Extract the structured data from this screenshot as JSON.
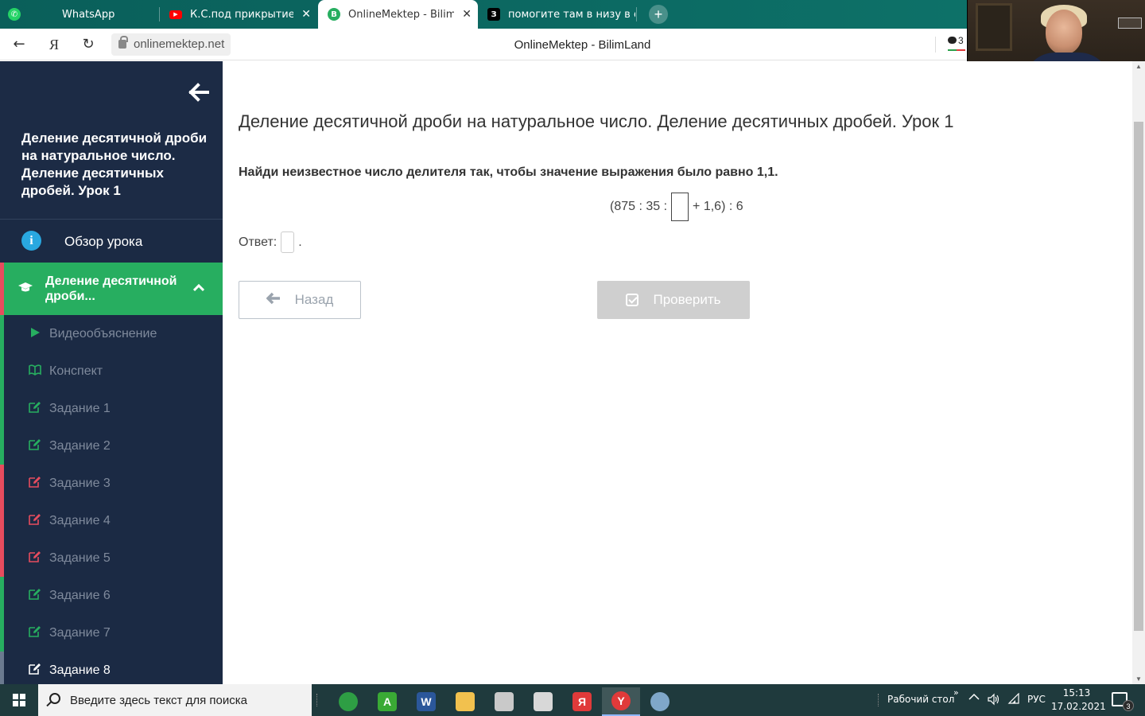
{
  "browser": {
    "tabs": [
      {
        "label": "WhatsApp",
        "icon": "whatsapp-icon"
      },
      {
        "label": "К.С.под прикрытием - С",
        "icon": "youtube-icon"
      },
      {
        "label": "OnlineMektep - BilimLa",
        "icon": "bilimland-icon"
      },
      {
        "label": "помогите там в низу в оте",
        "icon": "znanija-icon"
      }
    ],
    "url": "onlinemektep.net",
    "page_title": "OnlineMektep - BilimLand",
    "comment_count": "3",
    "yandex_glyph": "Я"
  },
  "sidebar": {
    "lesson_title": "Деление десятичной дроби на натуральное число. Деление десятичных дробей. Урок 1",
    "overview_label": "Обзор урока",
    "section_label": "Деление десятичной дроби...",
    "items": [
      {
        "label": "Видеообъяснение",
        "icon": "play-icon",
        "bar_color": "#27ae60",
        "icon_color": "#27ae60"
      },
      {
        "label": "Конспект",
        "icon": "book-icon",
        "bar_color": "#27ae60",
        "icon_color": "#27ae60"
      },
      {
        "label": "Задание 1",
        "icon": "edit-icon",
        "bar_color": "#27ae60",
        "icon_color": "#27ae60"
      },
      {
        "label": "Задание 2",
        "icon": "edit-icon",
        "bar_color": "#27ae60",
        "icon_color": "#27ae60"
      },
      {
        "label": "Задание 3",
        "icon": "edit-icon",
        "bar_color": "#e74c5e",
        "icon_color": "#e74c5e"
      },
      {
        "label": "Задание 4",
        "icon": "edit-icon",
        "bar_color": "#e74c5e",
        "icon_color": "#e74c5e"
      },
      {
        "label": "Задание 5",
        "icon": "edit-icon",
        "bar_color": "#e74c5e",
        "icon_color": "#e74c5e"
      },
      {
        "label": "Задание 6",
        "icon": "edit-icon",
        "bar_color": "#27ae60",
        "icon_color": "#27ae60"
      },
      {
        "label": "Задание 7",
        "icon": "edit-icon",
        "bar_color": "#27ae60",
        "icon_color": "#27ae60"
      },
      {
        "label": "Задание 8",
        "icon": "edit-icon",
        "bar_color": "#6b7a8f",
        "icon_color": "#ffffff",
        "current": true
      }
    ]
  },
  "main": {
    "title": "Деление десятичной дроби на натуральное число. Деление десятичных дробей. Урок 1",
    "task": "Найди неизвестное число делителя так, чтобы значение выражения было равно 1,1.",
    "expression_left": "(875 : 35 :",
    "expression_right": "+ 1,6) : 6",
    "answer_label": "Ответ:",
    "answer_suffix": ".",
    "back_button": "Назад",
    "check_button": "Проверить"
  },
  "taskbar": {
    "search_placeholder": "Введите здесь текст для поиска",
    "desktop_label": "Рабочий стол",
    "language": "РУС",
    "time": "15:13",
    "date": "17.02.2021",
    "notification_count": "3",
    "apps": [
      {
        "name": "chrome-app",
        "glyph": "",
        "color": "#2e9e44"
      },
      {
        "name": "autocad-app",
        "glyph": "A",
        "color": "#3aaa35"
      },
      {
        "name": "word-app",
        "glyph": "W",
        "color": "#2b579a"
      },
      {
        "name": "explorer-app",
        "glyph": "",
        "color": "#f2c14e"
      },
      {
        "name": "store-app",
        "glyph": "",
        "color": "#c9c9c9"
      },
      {
        "name": "roblox-app",
        "glyph": "",
        "color": "#d8d8d8"
      },
      {
        "name": "yandex-app",
        "glyph": "Я",
        "color": "#e03a3a"
      },
      {
        "name": "yandex-browser-app",
        "glyph": "Y",
        "color": "#e03a3a"
      },
      {
        "name": "paint-app",
        "glyph": "",
        "color": "#7fa7c9"
      }
    ]
  }
}
